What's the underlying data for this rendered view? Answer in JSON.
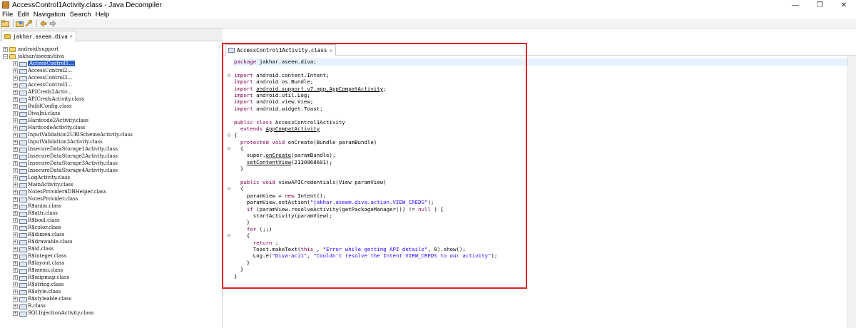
{
  "window": {
    "title": "AccessControl1Activity.class - Java Decompiler",
    "controls": [
      "—",
      "❐",
      "✕"
    ]
  },
  "menu": [
    "File",
    "Edit",
    "Navigation",
    "Search",
    "Help"
  ],
  "toolbar": {
    "icons": [
      "open-file-icon",
      "open-type-icon",
      "search-icon",
      "back-icon",
      "forward-icon"
    ]
  },
  "left_panel": {
    "tab_label": "jakhar.aseem.diva",
    "tree": [
      {
        "label": "android/support",
        "type": "package",
        "expander": "+"
      },
      {
        "label": "jakhar/aseem/diva",
        "type": "package",
        "expander": "−"
      },
      {
        "label": "AccessControl1...",
        "type": "class",
        "expander": "+",
        "selected": true
      },
      {
        "label": "AccessControl2...",
        "type": "class",
        "expander": "+"
      },
      {
        "label": "AccessControl3...",
        "type": "class",
        "expander": "+"
      },
      {
        "label": "AccessControl3...",
        "type": "class",
        "expander": "+"
      },
      {
        "label": "APICreds2Activ...",
        "type": "class",
        "expander": "+"
      },
      {
        "label": "APICredsActivity.class",
        "type": "class",
        "expander": "+"
      },
      {
        "label": "BuildConfig.class",
        "type": "class",
        "expander": "+"
      },
      {
        "label": "DivaJni.class",
        "type": "class",
        "expander": "+"
      },
      {
        "label": "Hardcode2Activity.class",
        "type": "class",
        "expander": "+"
      },
      {
        "label": "HardcodeActivity.class",
        "type": "class",
        "expander": "+"
      },
      {
        "label": "InputValidation2URISchemeActivity.class",
        "type": "class",
        "expander": "+"
      },
      {
        "label": "InputValidation3Activity.class",
        "type": "class",
        "expander": "+"
      },
      {
        "label": "InsecureDataStorage1Activity.class",
        "type": "class",
        "expander": "+"
      },
      {
        "label": "InsecureDataStorage2Activity.class",
        "type": "class",
        "expander": "+"
      },
      {
        "label": "InsecureDataStorage3Activity.class",
        "type": "class",
        "expander": "+"
      },
      {
        "label": "InsecureDataStorage4Activity.class",
        "type": "class",
        "expander": "+"
      },
      {
        "label": "LogActivity.class",
        "type": "class",
        "expander": "+"
      },
      {
        "label": "MainActivity.class",
        "type": "class",
        "expander": "+"
      },
      {
        "label": "NotesProvider$DBHelper.class",
        "type": "class",
        "expander": "+"
      },
      {
        "label": "NotesProvider.class",
        "type": "class",
        "expander": "+"
      },
      {
        "label": "R$anim.class",
        "type": "class",
        "expander": "+"
      },
      {
        "label": "R$attr.class",
        "type": "class",
        "expander": "+"
      },
      {
        "label": "R$bool.class",
        "type": "class",
        "expander": "+"
      },
      {
        "label": "R$color.class",
        "type": "class",
        "expander": "+"
      },
      {
        "label": "R$dimen.class",
        "type": "class",
        "expander": "+"
      },
      {
        "label": "R$drawable.class",
        "type": "class",
        "expander": "+"
      },
      {
        "label": "R$id.class",
        "type": "class",
        "expander": "+"
      },
      {
        "label": "R$integer.class",
        "type": "class",
        "expander": "+"
      },
      {
        "label": "R$layout.class",
        "type": "class",
        "expander": "+"
      },
      {
        "label": "R$menu.class",
        "type": "class",
        "expander": "+"
      },
      {
        "label": "R$mipmap.class",
        "type": "class",
        "expander": "+"
      },
      {
        "label": "R$string.class",
        "type": "class",
        "expander": "+"
      },
      {
        "label": "R$style.class",
        "type": "class",
        "expander": "+"
      },
      {
        "label": "R$styleable.class",
        "type": "class",
        "expander": "+"
      },
      {
        "label": "R.class",
        "type": "class",
        "expander": "+"
      },
      {
        "label": "SQLInjectionActivity.class",
        "type": "class",
        "expander": "+"
      }
    ]
  },
  "editor": {
    "tab_label": "AccessControl1Activity.class",
    "lines": [
      {
        "g": "",
        "segs": [
          [
            "kw",
            "package"
          ],
          [
            "",
            "jakhar.aseem.diva;"
          ]
        ]
      },
      {
        "g": "",
        "segs": []
      },
      {
        "g": "⊖",
        "segs": [
          [
            "kw",
            "import"
          ],
          [
            "",
            "android.content.Intent;"
          ]
        ]
      },
      {
        "g": "",
        "segs": [
          [
            "kw",
            "import"
          ],
          [
            "",
            "android.os.Bundle;"
          ]
        ]
      },
      {
        "g": "",
        "segs": [
          [
            "kw",
            "import"
          ],
          [
            "ul",
            "android.support.v7.app.AppCompatActivity"
          ],
          [
            "",
            ";"
          ]
        ]
      },
      {
        "g": "",
        "segs": [
          [
            "kw",
            "import"
          ],
          [
            "",
            "android.util.Log;"
          ]
        ]
      },
      {
        "g": "",
        "segs": [
          [
            "kw",
            "import"
          ],
          [
            "",
            "android.view.View;"
          ]
        ]
      },
      {
        "g": "",
        "segs": [
          [
            "kw",
            "import"
          ],
          [
            "",
            "android.widget.Toast;"
          ]
        ]
      },
      {
        "g": "",
        "segs": []
      },
      {
        "g": "",
        "segs": [
          [
            "kw",
            "public class"
          ],
          [
            "",
            "AccessControl1Activity"
          ]
        ]
      },
      {
        "g": "",
        "segs": [
          [
            "",
            "  "
          ],
          [
            "kw",
            "extends"
          ],
          [
            "ul",
            "AppCompatActivity"
          ]
        ]
      },
      {
        "g": "⊖",
        "segs": [
          [
            "",
            "{"
          ]
        ]
      },
      {
        "g": "",
        "segs": [
          [
            "",
            "  "
          ],
          [
            "kw",
            "protected void"
          ],
          [
            "",
            "onCreate(Bundle paramBundle)"
          ]
        ]
      },
      {
        "g": "⊖",
        "segs": [
          [
            "",
            "  {"
          ]
        ]
      },
      {
        "g": "",
        "segs": [
          [
            "",
            "    super."
          ],
          [
            "ul",
            "onCreate"
          ],
          [
            "",
            "(paramBundle);"
          ]
        ]
      },
      {
        "g": "",
        "segs": [
          [
            "",
            "    "
          ],
          [
            "ul",
            "setContentView"
          ],
          [
            "",
            "(2130968601);"
          ]
        ]
      },
      {
        "g": "",
        "segs": [
          [
            "",
            "  }"
          ]
        ]
      },
      {
        "g": "",
        "segs": []
      },
      {
        "g": "",
        "segs": [
          [
            "",
            "  "
          ],
          [
            "kw",
            "public void"
          ],
          [
            "",
            "viewAPICredentials(View paramView)"
          ]
        ]
      },
      {
        "g": "⊖",
        "segs": [
          [
            "",
            "  {"
          ]
        ]
      },
      {
        "g": "",
        "segs": [
          [
            "",
            "    paramView = "
          ],
          [
            "kw",
            "new"
          ],
          [
            "",
            "Intent();"
          ]
        ]
      },
      {
        "g": "",
        "segs": [
          [
            "",
            "    paramView.setAction("
          ],
          [
            "str",
            "\"jakhar.aseem.diva.action.VIEW_CREDS\""
          ],
          [
            "",
            ");"
          ]
        ]
      },
      {
        "g": "",
        "segs": [
          [
            "",
            "    "
          ],
          [
            "kw",
            "if"
          ],
          [
            "",
            "(paramView.resolveActivity(getPackageManager()) != "
          ],
          [
            "kw",
            "null"
          ],
          [
            "",
            ") {"
          ]
        ]
      },
      {
        "g": "",
        "segs": [
          [
            "",
            "      startActivity(paramView);"
          ]
        ]
      },
      {
        "g": "",
        "segs": [
          [
            "",
            "    }"
          ]
        ]
      },
      {
        "g": "",
        "segs": [
          [
            "",
            "    "
          ],
          [
            "kw",
            "for"
          ],
          [
            "",
            "(;;)"
          ]
        ]
      },
      {
        "g": "⊖",
        "segs": [
          [
            "",
            "    {"
          ]
        ]
      },
      {
        "g": "",
        "segs": [
          [
            "",
            "      "
          ],
          [
            "kw",
            "return"
          ],
          [
            "",
            ";"
          ]
        ]
      },
      {
        "g": "",
        "segs": [
          [
            "",
            "      Toast.makeText("
          ],
          [
            "kw",
            "this"
          ],
          [
            "",
            ", "
          ],
          [
            "str",
            "\"Error while getting API details\""
          ],
          [
            "",
            ", 0).show();"
          ]
        ]
      },
      {
        "g": "",
        "segs": [
          [
            "",
            "      Log.e("
          ],
          [
            "str",
            "\"Diva-aci1\""
          ],
          [
            "",
            ", "
          ],
          [
            "str",
            "\"Couldn't resolve the Intent VIEW_CREDS to our activity\""
          ],
          [
            "",
            ");"
          ]
        ]
      },
      {
        "g": "",
        "segs": [
          [
            "",
            "    }"
          ]
        ]
      },
      {
        "g": "",
        "segs": [
          [
            "",
            "  }"
          ]
        ]
      },
      {
        "g": "",
        "segs": [
          [
            "",
            "}"
          ]
        ]
      }
    ]
  },
  "colors": {
    "keyword": "#7f0055",
    "string": "#2a00ff",
    "selection": "#2f62c9",
    "highlight_box": "#e02020"
  }
}
